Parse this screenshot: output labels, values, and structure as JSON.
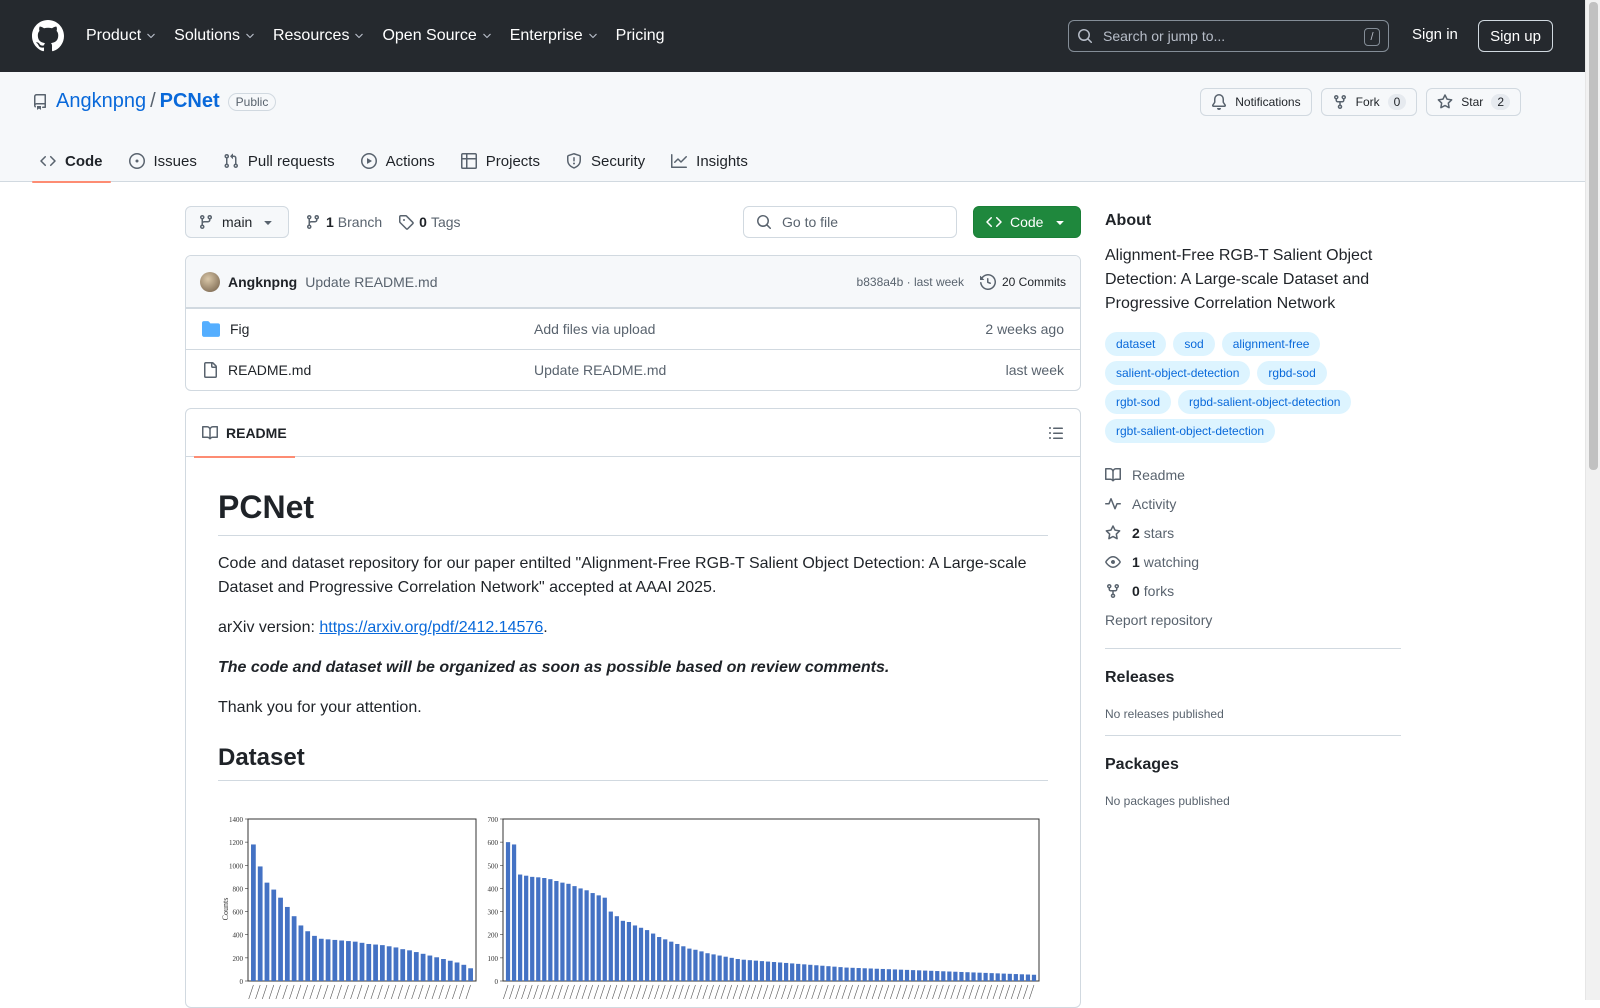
{
  "header": {
    "nav": [
      "Product",
      "Solutions",
      "Resources",
      "Open Source",
      "Enterprise",
      "Pricing"
    ],
    "search_placeholder": "Search or jump to...",
    "search_shortcut": "/",
    "sign_in": "Sign in",
    "sign_up": "Sign up"
  },
  "repo": {
    "owner": "Angknpng",
    "separator": "/",
    "name": "PCNet",
    "visibility": "Public",
    "notifications_label": "Notifications",
    "fork_label": "Fork",
    "fork_count": "0",
    "star_label": "Star",
    "star_count": "2",
    "tabs": [
      "Code",
      "Issues",
      "Pull requests",
      "Actions",
      "Projects",
      "Security",
      "Insights"
    ],
    "active_tab": "Code"
  },
  "toolbar": {
    "branch": "main",
    "branches_count": "1",
    "branches_label": "Branch",
    "tags_count": "0",
    "tags_label": "Tags",
    "goto_placeholder": "Go to file",
    "code_button": "Code"
  },
  "commit": {
    "author": "Angknpng",
    "message": "Update README.md",
    "hash": "b838a4b",
    "separator": "·",
    "time": "last week",
    "commits_label": "20 Commits"
  },
  "files": [
    {
      "type": "folder",
      "name": "Fig",
      "message": "Add files via upload",
      "age": "2 weeks ago"
    },
    {
      "type": "file",
      "name": "README.md",
      "message": "Update README.md",
      "age": "last week"
    }
  ],
  "readme": {
    "tab_label": "README",
    "h1": "PCNet",
    "intro": "Code and dataset repository for our paper entilted \"Alignment-Free RGB-T Salient Object Detection: A Large-scale Dataset and Progressive Correlation Network\" accepted at AAAI 2025.",
    "arxiv_prefix": "arXiv version: ",
    "arxiv_link": "https://arxiv.org/pdf/2412.14576",
    "arxiv_suffix": ".",
    "note": "The code and dataset will be organized as soon as possible based on review comments.",
    "thanks": "Thank you for your attention.",
    "h2": "Dataset",
    "figure": {
      "left_chart": {
        "y_ticks": [
          "1400",
          "1200",
          "1000",
          "800",
          "600",
          "400",
          "200",
          "0"
        ],
        "ylabel": "Counts",
        "values": [
          1180,
          990,
          850,
          790,
          720,
          640,
          560,
          480,
          430,
          390,
          365,
          360,
          355,
          350,
          345,
          340,
          330,
          320,
          315,
          310,
          300,
          290,
          275,
          265,
          250,
          235,
          220,
          205,
          190,
          175,
          160,
          140,
          110
        ]
      },
      "right_chart": {
        "y_ticks": [
          "700",
          "600",
          "500",
          "400",
          "300",
          "200",
          "100",
          "0"
        ],
        "values": [
          600,
          590,
          460,
          455,
          450,
          448,
          445,
          440,
          432,
          425,
          420,
          410,
          400,
          392,
          380,
          370,
          360,
          300,
          280,
          260,
          255,
          240,
          230,
          220,
          205,
          190,
          180,
          170,
          160,
          150,
          140,
          135,
          128,
          120,
          115,
          110,
          105,
          100,
          95,
          92,
          90,
          88,
          86,
          84,
          82,
          80,
          78,
          76,
          74,
          72,
          70,
          68,
          66,
          64,
          62,
          60,
          58,
          57,
          56,
          55,
          54,
          53,
          52,
          51,
          50,
          49,
          48,
          47,
          46,
          45,
          44,
          43,
          42,
          41,
          40,
          39,
          38,
          37,
          36,
          35,
          34,
          33,
          32,
          31,
          30,
          29,
          28,
          27
        ]
      }
    }
  },
  "sidebar": {
    "about_title": "About",
    "description": "Alignment-Free RGB-T Salient Object Detection: A Large-scale Dataset and Progressive Correlation Network",
    "topics": [
      "dataset",
      "sod",
      "alignment-free",
      "salient-object-detection",
      "rgbd-sod",
      "rgbt-sod",
      "rgbd-salient-object-detection",
      "rgbt-salient-object-detection"
    ],
    "links": {
      "readme": "Readme",
      "activity": "Activity",
      "stars_count": "2",
      "stars_label": "stars",
      "watching_count": "1",
      "watching_label": "watching",
      "forks_count": "0",
      "forks_label": "forks",
      "report": "Report repository"
    },
    "releases_title": "Releases",
    "releases_none": "No releases published",
    "packages_title": "Packages",
    "packages_none": "No packages published"
  },
  "colors": {
    "header_bg": "#25292e",
    "link": "#0969da",
    "code_button": "#1f883d",
    "tab_underline": "#fd8c73",
    "bar": "#4472c4"
  }
}
